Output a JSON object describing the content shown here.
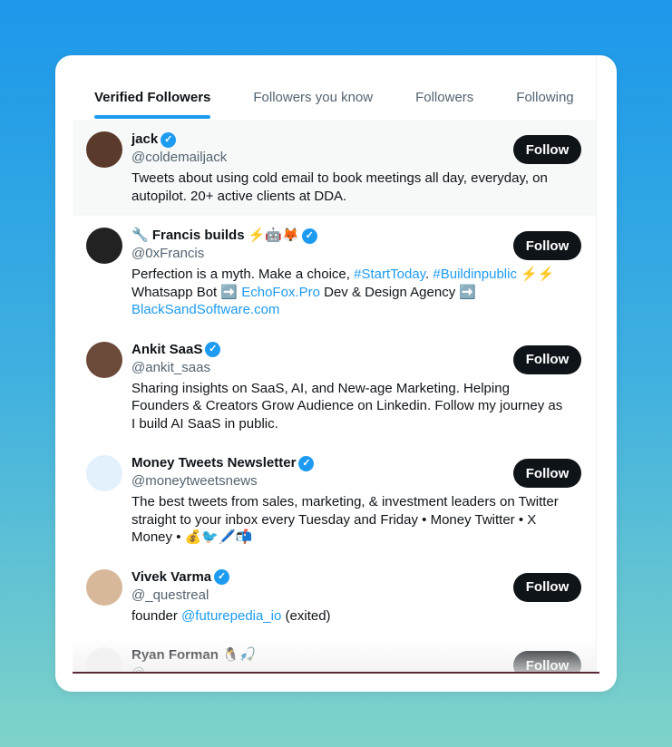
{
  "tabs": [
    {
      "label": "Verified Followers",
      "active": true
    },
    {
      "label": "Followers you know"
    },
    {
      "label": "Followers"
    },
    {
      "label": "Following"
    }
  ],
  "accent": "#1d9bf0",
  "follow_label": "Follow",
  "users": [
    {
      "name": "jack",
      "handle": "@coldemailjack",
      "bio": [
        {
          "t": "Tweets about using cold email to book meetings all day, everyday, on autopilot. 20+ active clients at DDA."
        }
      ],
      "avatar_color": "#5a3a2a"
    },
    {
      "name": "🔧 Francis builds ⚡🤖🦊",
      "handle": "@0xFrancis",
      "bio": [
        {
          "t": "Perfection is a myth. Make a choice, "
        },
        {
          "t": "#StartToday",
          "link": true
        },
        {
          "t": ". "
        },
        {
          "t": "#Buildinpublic",
          "link": true
        },
        {
          "t": " ⚡⚡ Whatsapp Bot ➡️ "
        },
        {
          "t": "EchoFox.Pro",
          "link": true
        },
        {
          "t": " Dev & Design Agency ➡️ "
        },
        {
          "t": "BlackSandSoftware.com",
          "link": true
        }
      ],
      "avatar_color": "#222"
    },
    {
      "name": "Ankit SaaS",
      "handle": "@ankit_saas",
      "bio": [
        {
          "t": "Sharing insights on SaaS, AI, and New-age Marketing. Helping Founders & Creators Grow Audience on Linkedin. Follow my journey as I build AI SaaS in public."
        }
      ],
      "avatar_color": "#6b4a3a"
    },
    {
      "name": "Money Tweets Newsletter",
      "handle": "@moneytweetsnews",
      "bio": [
        {
          "t": "The best tweets from sales, marketing, & investment leaders on Twitter straight to your inbox every Tuesday and Friday • Money Twitter • X Money • 💰🐦🖊️📬"
        }
      ],
      "avatar_color": "#e3f1fd"
    },
    {
      "name": "Vivek Varma",
      "handle": "@_questreal",
      "bio": [
        {
          "t": "founder "
        },
        {
          "t": "@futurepedia_io",
          "link": true
        },
        {
          "t": " (exited)"
        }
      ],
      "avatar_color": "#d8b89a"
    },
    {
      "name": "Ryan Forman 🐧🎣",
      "handle": "@...",
      "bio": [],
      "avatar_color": "#f4f4f4",
      "verified": false
    }
  ]
}
